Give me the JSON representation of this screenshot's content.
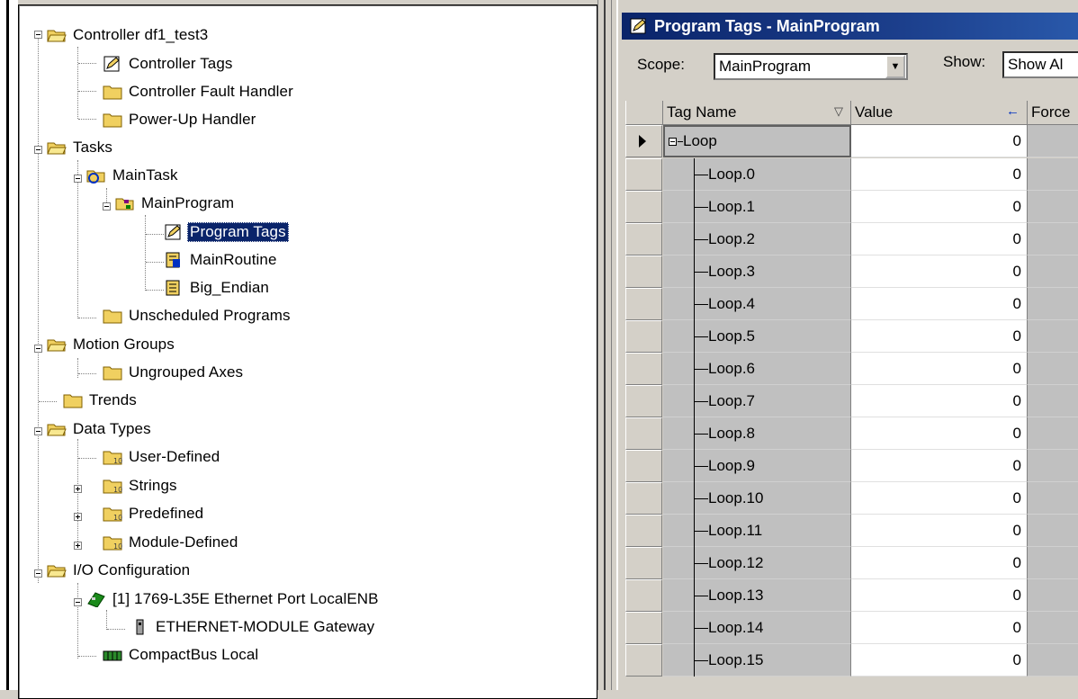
{
  "tree": {
    "items": [
      {
        "label": "Controller df1_test3",
        "icon": "folder-open-icon"
      },
      {
        "label": "Controller Tags",
        "icon": "tags-icon"
      },
      {
        "label": "Controller Fault Handler",
        "icon": "folder-icon"
      },
      {
        "label": "Power-Up Handler",
        "icon": "folder-icon"
      },
      {
        "label": "Tasks",
        "icon": "folder-open-icon"
      },
      {
        "label": "MainTask",
        "icon": "task-icon"
      },
      {
        "label": "MainProgram",
        "icon": "program-icon"
      },
      {
        "label": "Program Tags",
        "icon": "tags-icon",
        "selected": true
      },
      {
        "label": "MainRoutine",
        "icon": "main-routine-icon"
      },
      {
        "label": "Big_Endian",
        "icon": "routine-icon"
      },
      {
        "label": "Unscheduled Programs",
        "icon": "folder-icon"
      },
      {
        "label": "Motion Groups",
        "icon": "folder-open-icon"
      },
      {
        "label": "Ungrouped Axes",
        "icon": "folder-icon"
      },
      {
        "label": "Trends",
        "icon": "folder-icon"
      },
      {
        "label": "Data Types",
        "icon": "folder-open-icon"
      },
      {
        "label": "User-Defined",
        "icon": "datatype-folder-icon"
      },
      {
        "label": "Strings",
        "icon": "datatype-folder-icon"
      },
      {
        "label": "Predefined",
        "icon": "datatype-folder-icon"
      },
      {
        "label": "Module-Defined",
        "icon": "datatype-folder-icon"
      },
      {
        "label": "I/O Configuration",
        "icon": "folder-open-icon"
      },
      {
        "label": "[1] 1769-L35E Ethernet Port LocalENB",
        "icon": "ethernet-module-icon"
      },
      {
        "label": "ETHERNET-MODULE Gateway",
        "icon": "device-icon"
      },
      {
        "label": "CompactBus Local",
        "icon": "bus-icon"
      }
    ]
  },
  "panel": {
    "title": "Program Tags - MainProgram",
    "scope_label": "Scope:",
    "scope_value": "MainProgram",
    "show_label": "Show:",
    "show_value": "Show Al"
  },
  "grid": {
    "columns": {
      "tag_name": "Tag Name",
      "value": "Value",
      "force": "Force"
    },
    "parent": {
      "name": "Loop",
      "value": "0"
    },
    "rows": [
      {
        "name": "Loop.0",
        "value": "0"
      },
      {
        "name": "Loop.1",
        "value": "0"
      },
      {
        "name": "Loop.2",
        "value": "0"
      },
      {
        "name": "Loop.3",
        "value": "0"
      },
      {
        "name": "Loop.4",
        "value": "0"
      },
      {
        "name": "Loop.5",
        "value": "0"
      },
      {
        "name": "Loop.6",
        "value": "0"
      },
      {
        "name": "Loop.7",
        "value": "0"
      },
      {
        "name": "Loop.8",
        "value": "0"
      },
      {
        "name": "Loop.9",
        "value": "0"
      },
      {
        "name": "Loop.10",
        "value": "0"
      },
      {
        "name": "Loop.11",
        "value": "0"
      },
      {
        "name": "Loop.12",
        "value": "0"
      },
      {
        "name": "Loop.13",
        "value": "0"
      },
      {
        "name": "Loop.14",
        "value": "0"
      },
      {
        "name": "Loop.15",
        "value": "0"
      }
    ]
  },
  "colors": {
    "selection": "#0a246a",
    "folder": "#f0d060",
    "window_bg": "#d4d0c8"
  }
}
